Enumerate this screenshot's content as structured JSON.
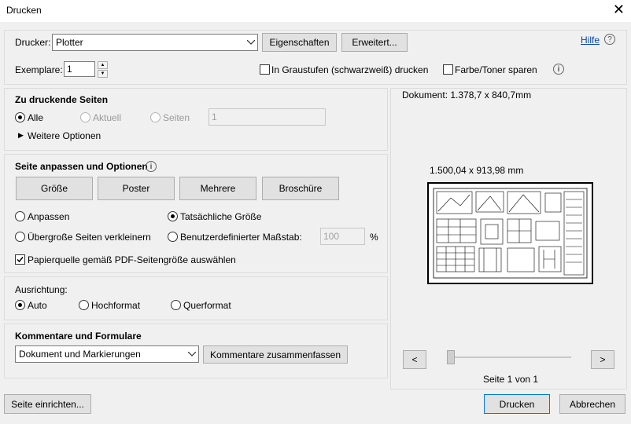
{
  "window": {
    "title": "Drucken"
  },
  "printer": {
    "label": "Drucker:",
    "value": "Plotter",
    "properties_label": "Eigenschaften",
    "advanced_label": "Erweitert...",
    "help_label": "Hilfe"
  },
  "copies": {
    "label": "Exemplare:",
    "value": "1",
    "grayscale_label": "In Graustufen (schwarzweiß) drucken",
    "save_toner_label": "Farbe/Toner sparen"
  },
  "pages": {
    "section_title": "Zu druckende Seiten",
    "all_label": "Alle",
    "current_label": "Aktuell",
    "pages_label": "Seiten",
    "pages_value": "1",
    "more_options_label": "Weitere Optionen"
  },
  "sizing": {
    "section_title": "Seite anpassen und Optionen",
    "tabs": [
      "Größe",
      "Poster",
      "Mehrere",
      "Broschüre"
    ],
    "fit_label": "Anpassen",
    "actual_size_label": "Tatsächliche Größe",
    "shrink_label": "Übergroße Seiten verkleinern",
    "custom_scale_label": "Benutzerdefinierter Maßstab:",
    "custom_scale_value": "100",
    "percent": "%",
    "paper_source_label": "Papierquelle gemäß PDF-Seitengröße auswählen"
  },
  "orientation": {
    "section_title": "Ausrichtung:",
    "auto_label": "Auto",
    "portrait_label": "Hochformat",
    "landscape_label": "Querformat"
  },
  "comments": {
    "section_title": "Kommentare und Formulare",
    "select_value": "Dokument und Markierungen",
    "summarize_label": "Kommentare zusammenfassen"
  },
  "preview": {
    "document_size": "Dokument: 1.378,7 x 840,7mm",
    "paper_size": "1.500,04 x 913,98 mm",
    "prev_label": "<",
    "next_label": ">",
    "page_info": "Seite 1 von 1"
  },
  "footer": {
    "page_setup_label": "Seite einrichten...",
    "print_label": "Drucken",
    "cancel_label": "Abbrechen"
  }
}
